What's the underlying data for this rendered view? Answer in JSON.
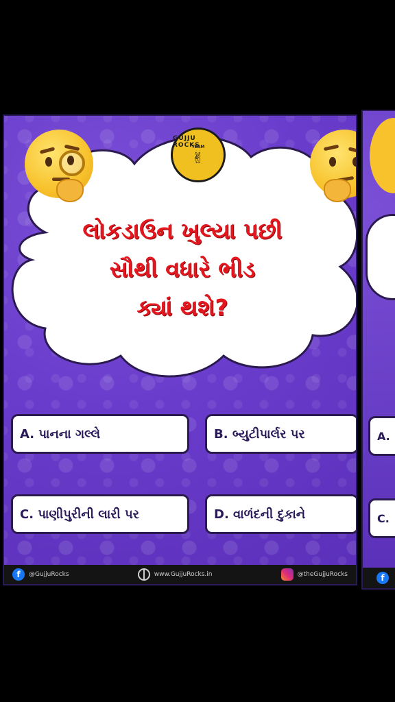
{
  "brand": {
    "logo_text": "GUJJU ROCKS",
    "logo_sub": "TEAM"
  },
  "question": {
    "line1": "લોકડાઉન ખુલ્યા પછી",
    "line2": "સૌથી વધારે ભીડ",
    "line3": "ક્યાં થશે?"
  },
  "options": [
    {
      "label": "A. પાનના ગલ્લે"
    },
    {
      "label": "B. બ્યુટીપાર્લર પર"
    },
    {
      "label": "C. પાણીપુરીની લારી પર"
    },
    {
      "label": "D. વાળંદની દુકાને"
    }
  ],
  "footer": {
    "facebook": "@GujjuRocks",
    "website": "www.GujjuRocks.in",
    "instagram": "@theGujjuRocks"
  },
  "next_card": {
    "opt_a": "A.",
    "opt_c": "C."
  },
  "colors": {
    "background": "#6a3ccc",
    "question": "#e4161e",
    "option_text": "#2a1a5a"
  },
  "icons": [
    "thinking-face-emoji",
    "monocle-face-emoji",
    "facebook-icon",
    "globe-icon",
    "instagram-icon"
  ]
}
